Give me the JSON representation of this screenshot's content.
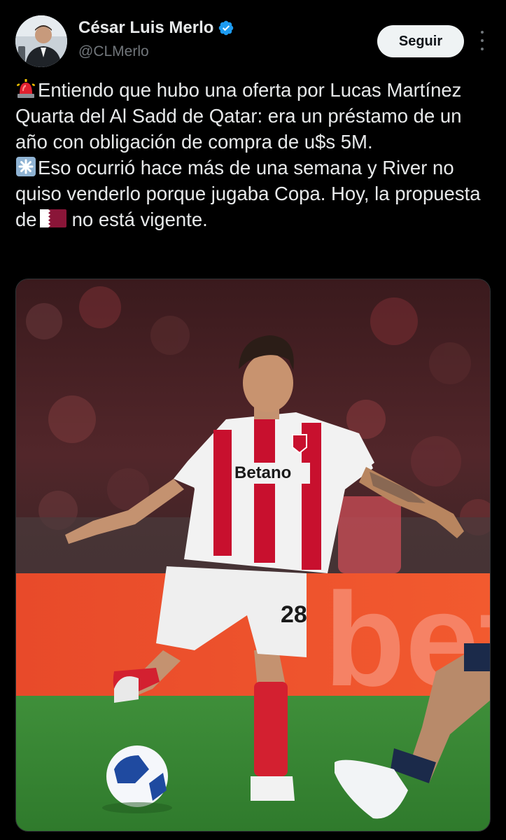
{
  "author": {
    "name": "César Luis Merlo",
    "handle": "@CLMerlo",
    "verified": true,
    "avatar_icon": "avatar-person-icon"
  },
  "actions": {
    "follow_label": "Seguir",
    "more_icon": "more-vertical-icon"
  },
  "tweet": {
    "line1_emoji": "rotating-light-icon",
    "line1": "Entiendo que hubo una oferta por Lucas Martínez Quarta del Al Sadd de Qatar: era un préstamo de un año con obligación de compra de u$s 5M.",
    "line2_emoji": "eight-spoked-asterisk-icon",
    "line2_before_flag": "Eso ocurrió hace más de una semana y River no quiso venderlo porque jugaba Copa. Hoy, la propuesta de",
    "flag": "qatar-flag-icon",
    "line2_after_flag": "no está vigente."
  },
  "media": {
    "type": "photo",
    "jersey_sponsor": "Betano",
    "shirt_number": "28",
    "board_text": "bet"
  },
  "colors": {
    "background": "#000000",
    "text": "#e7e9ea",
    "muted": "#71767b",
    "verified": "#1d9bf0",
    "button_bg": "#eff3f4",
    "button_text": "#0f1419"
  }
}
